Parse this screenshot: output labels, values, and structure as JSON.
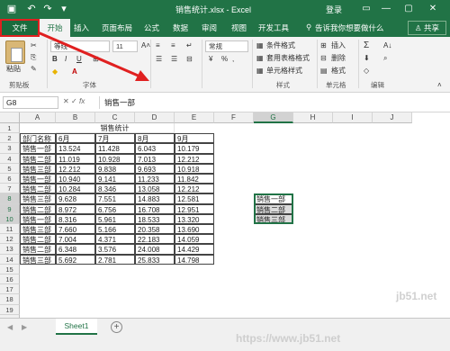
{
  "window": {
    "title": "销售统计.xlsx - Excel",
    "login": "登录",
    "minimize_glyph": "—",
    "restore_glyph": "▢",
    "close_glyph": "✕"
  },
  "tabs": {
    "file": "文件",
    "home": "开始",
    "insert": "插入",
    "page_layout": "页面布局",
    "formulas": "公式",
    "data": "数据",
    "review": "审阅",
    "view": "视图",
    "developer": "开发工具",
    "tellme": "告诉我你想要做什么",
    "share": "共享"
  },
  "ribbon": {
    "paste_label": "粘贴",
    "clipboard_label": "剪贴板",
    "font_name": "等线",
    "font_size": "11",
    "font_label": "字体",
    "bold": "B",
    "italic": "I",
    "underline": "U",
    "number_format": "常规",
    "percent": "%",
    "style_label": "样式",
    "cond_format": "条件格式",
    "table_format": "套用表格格式",
    "cell_style": "单元格样式",
    "insert": "插入",
    "delete": "删除",
    "format": "格式",
    "cells_label": "单元格",
    "edit_label": "编辑"
  },
  "formula_bar": {
    "name_box": "G8",
    "fx": "fx",
    "value": "销售一部"
  },
  "columns": [
    "A",
    "B",
    "C",
    "D",
    "E",
    "F",
    "G",
    "H",
    "I",
    "J"
  ],
  "rows": [
    "1",
    "2",
    "3",
    "4",
    "5",
    "6",
    "7",
    "8",
    "9",
    "10",
    "11",
    "12",
    "13",
    "14",
    "15",
    "16",
    "17",
    "18",
    "19",
    "20"
  ],
  "sheet": {
    "title": "销售统计",
    "headers": [
      "部门名称",
      "6月",
      "7月",
      "8月",
      "9月"
    ],
    "data": [
      [
        "销售一部",
        "13.524",
        "11.428",
        "6.043",
        "10.179"
      ],
      [
        "销售二部",
        "11.019",
        "10.928",
        "7.013",
        "12.212"
      ],
      [
        "销售三部",
        "12.212",
        "9.838",
        "9.693",
        "10.918"
      ],
      [
        "销售一部",
        "10.940",
        "9.141",
        "11.233",
        "11.842"
      ],
      [
        "销售二部",
        "10.284",
        "8.346",
        "13.058",
        "12.212"
      ],
      [
        "销售三部",
        "9.628",
        "7.551",
        "14.883",
        "12.581"
      ],
      [
        "销售二部",
        "8.972",
        "6.756",
        "16.708",
        "12.951"
      ],
      [
        "销售一部",
        "8.316",
        "5.961",
        "18.533",
        "13.320"
      ],
      [
        "销售三部",
        "7.660",
        "5.166",
        "20.358",
        "13.690"
      ],
      [
        "销售二部",
        "7.004",
        "4.371",
        "22.183",
        "14.059"
      ],
      [
        "销售二部",
        "6.348",
        "3.576",
        "24.008",
        "14.429"
      ],
      [
        "销售三部",
        "5.692",
        "2.781",
        "25.833",
        "14.798"
      ]
    ],
    "g_column": [
      "销售一部",
      "销售二部",
      "销售三部"
    ]
  },
  "sheet_tabs": {
    "sheet1": "Sheet1",
    "add": "+"
  },
  "watermarks": {
    "top": "jb51.net",
    "bottom": "https://www.jb51.net"
  }
}
